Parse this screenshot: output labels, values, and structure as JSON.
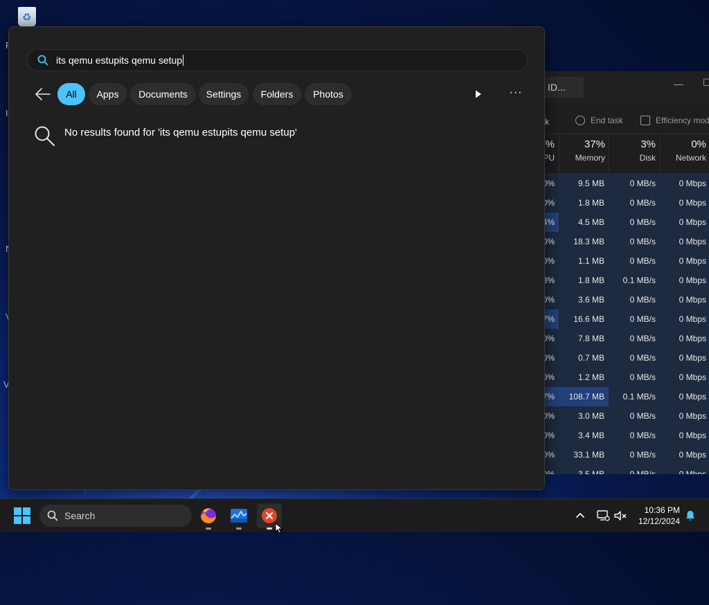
{
  "desktop": {
    "icon_letters": [
      "R",
      "I",
      "N",
      "V",
      "V"
    ]
  },
  "task_manager": {
    "title_button": "ID...",
    "toolbar": {
      "run_task_tail": "sk",
      "end_task": "End task",
      "efficiency": "Efficiency mod"
    },
    "columns": [
      {
        "pct": "%",
        "label": "PU"
      },
      {
        "pct": "37%",
        "label": "Memory"
      },
      {
        "pct": "3%",
        "label": "Disk"
      },
      {
        "pct": "0%",
        "label": "Network"
      }
    ],
    "rows": [
      {
        "cpu": "0%",
        "mem": "9.5 MB",
        "disk": "0 MB/s",
        "net": "0 Mbps",
        "cpu_heat": 1,
        "mem_heat": 1
      },
      {
        "cpu": "0%",
        "mem": "1.8 MB",
        "disk": "0 MB/s",
        "net": "0 Mbps",
        "cpu_heat": 1,
        "mem_heat": 1
      },
      {
        "cpu": "4%",
        "mem": "4.5 MB",
        "disk": "0 MB/s",
        "net": "0 Mbps",
        "cpu_heat": 2,
        "mem_heat": 1
      },
      {
        "cpu": "0%",
        "mem": "18.3 MB",
        "disk": "0 MB/s",
        "net": "0 Mbps",
        "cpu_heat": 1,
        "mem_heat": 1
      },
      {
        "cpu": "0%",
        "mem": "1.1 MB",
        "disk": "0 MB/s",
        "net": "0 Mbps",
        "cpu_heat": 1,
        "mem_heat": 1
      },
      {
        "cpu": "3%",
        "mem": "1.8 MB",
        "disk": "0.1 MB/s",
        "net": "0 Mbps",
        "cpu_heat": 1,
        "mem_heat": 1
      },
      {
        "cpu": "0%",
        "mem": "3.6 MB",
        "disk": "0 MB/s",
        "net": "0 Mbps",
        "cpu_heat": 1,
        "mem_heat": 1
      },
      {
        "cpu": "7%",
        "mem": "16.6 MB",
        "disk": "0 MB/s",
        "net": "0 Mbps",
        "cpu_heat": 2,
        "mem_heat": 1
      },
      {
        "cpu": "0%",
        "mem": "7.8 MB",
        "disk": "0 MB/s",
        "net": "0 Mbps",
        "cpu_heat": 1,
        "mem_heat": 1
      },
      {
        "cpu": "0%",
        "mem": "0.7 MB",
        "disk": "0 MB/s",
        "net": "0 Mbps",
        "cpu_heat": 1,
        "mem_heat": 1
      },
      {
        "cpu": "0%",
        "mem": "1.2 MB",
        "disk": "0 MB/s",
        "net": "0 Mbps",
        "cpu_heat": 1,
        "mem_heat": 1
      },
      {
        "cpu": "7%",
        "mem": "108.7 MB",
        "disk": "0.1 MB/s",
        "net": "0 Mbps",
        "cpu_heat": 2,
        "mem_heat": 2
      },
      {
        "cpu": "0%",
        "mem": "3.0 MB",
        "disk": "0 MB/s",
        "net": "0 Mbps",
        "cpu_heat": 1,
        "mem_heat": 1
      },
      {
        "cpu": "0%",
        "mem": "3.4 MB",
        "disk": "0 MB/s",
        "net": "0 Mbps",
        "cpu_heat": 1,
        "mem_heat": 1
      },
      {
        "cpu": "0%",
        "mem": "33.1 MB",
        "disk": "0 MB/s",
        "net": "0 Mbps",
        "cpu_heat": 1,
        "mem_heat": 1
      },
      {
        "cpu": "0%",
        "mem": "3.5 MB",
        "disk": "0 MB/s",
        "net": "0 Mbps",
        "cpu_heat": 1,
        "mem_heat": 1
      }
    ]
  },
  "search_flyout": {
    "query": "its qemu estupits qemu setup",
    "filters": [
      "All",
      "Apps",
      "Documents",
      "Settings",
      "Folders",
      "Photos"
    ],
    "active_filter": "All",
    "more_label": "···",
    "no_results_text": "No results found for 'its qemu estupits qemu setup'"
  },
  "taskbar": {
    "search_label": "Search",
    "apps": [
      "firefox-icon",
      "task-manager-icon",
      "close-app-icon"
    ],
    "time": "10:36 PM",
    "date": "12/12/2024"
  },
  "colors": {
    "accent": "#4cc2ff",
    "flyout_bg": "#202020",
    "taskbar_bg": "#1c1c1c",
    "heat_low": "#1d2a3f",
    "heat_mid": "#22407a",
    "close_red": "#e0452a"
  }
}
